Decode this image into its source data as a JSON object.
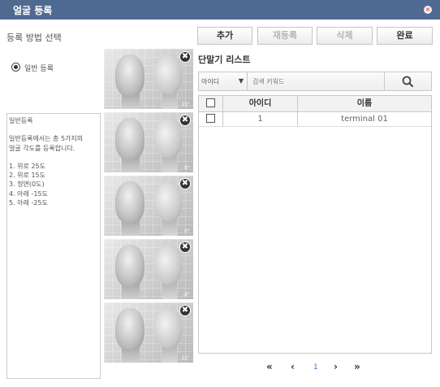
{
  "window": {
    "title": "얼굴 등록",
    "close_glyph": "×"
  },
  "method": {
    "label": "등록 방법 선택",
    "option_label": "일반 등록"
  },
  "description": "일반등록\n\n일반등록에서는 총 5가지의\n얼굴 각도를 등록합니다.\n\n1. 위로 25도\n2. 위로 15도\n3. 정면(0도)\n4. 아래 -15도\n5. 아래 -25도",
  "faces": [
    {
      "angle": "15°"
    },
    {
      "angle": "8°"
    },
    {
      "angle": "0°"
    },
    {
      "angle": "-8°"
    },
    {
      "angle": "-15°"
    }
  ],
  "face_remove_glyph": "✖",
  "toolbar": {
    "add": "추가",
    "reregister": "재등록",
    "delete": "삭제",
    "done": "완료"
  },
  "list": {
    "title": "단말기 리스트",
    "search": {
      "field_selected": "아이디",
      "placeholder": "검색 키워드"
    },
    "columns": [
      "아이디",
      "이름"
    ],
    "rows": [
      {
        "id": "1",
        "name": "terminal 01"
      }
    ]
  },
  "pagination": {
    "first": "«",
    "prev": "‹",
    "page": "1",
    "next": "›",
    "last": "»"
  }
}
